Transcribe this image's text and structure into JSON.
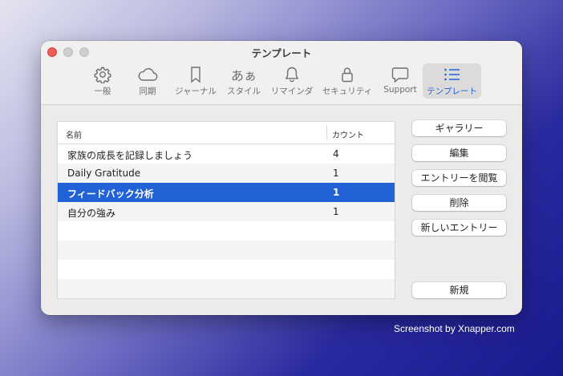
{
  "window": {
    "title": "テンプレート"
  },
  "toolbar": {
    "tabs": [
      {
        "label": "一般",
        "icon": "gear-icon"
      },
      {
        "label": "同期",
        "icon": "cloud-icon"
      },
      {
        "label": "ジャーナル",
        "icon": "bookmark-icon"
      },
      {
        "label": "スタイル",
        "icon": "text-style-icon",
        "glyph": "あぁ"
      },
      {
        "label": "リマインダ",
        "icon": "bell-icon"
      },
      {
        "label": "セキュリティ",
        "icon": "lock-icon"
      },
      {
        "label": "Support",
        "icon": "speech-bubble-icon"
      },
      {
        "label": "テンプレート",
        "icon": "list-icon",
        "active": true
      }
    ]
  },
  "table": {
    "columns": {
      "name": "名前",
      "count": "カウント"
    },
    "rows": [
      {
        "name": "家族の成長を記録しましょう",
        "count": "4"
      },
      {
        "name": "Daily Gratitude",
        "count": "1"
      },
      {
        "name": "フィードバック分析",
        "count": "1",
        "selected": true
      },
      {
        "name": "自分の強み",
        "count": "1"
      }
    ]
  },
  "buttons": {
    "gallery": "ギャラリー",
    "edit": "編集",
    "view_entries": "エントリーを閲覧",
    "delete": "削除",
    "new_entry": "新しいエントリー",
    "new": "新規"
  },
  "watermark": "Screenshot by Xnapper.com",
  "colors": {
    "accent": "#2163d7",
    "close": "#ee5d56"
  }
}
